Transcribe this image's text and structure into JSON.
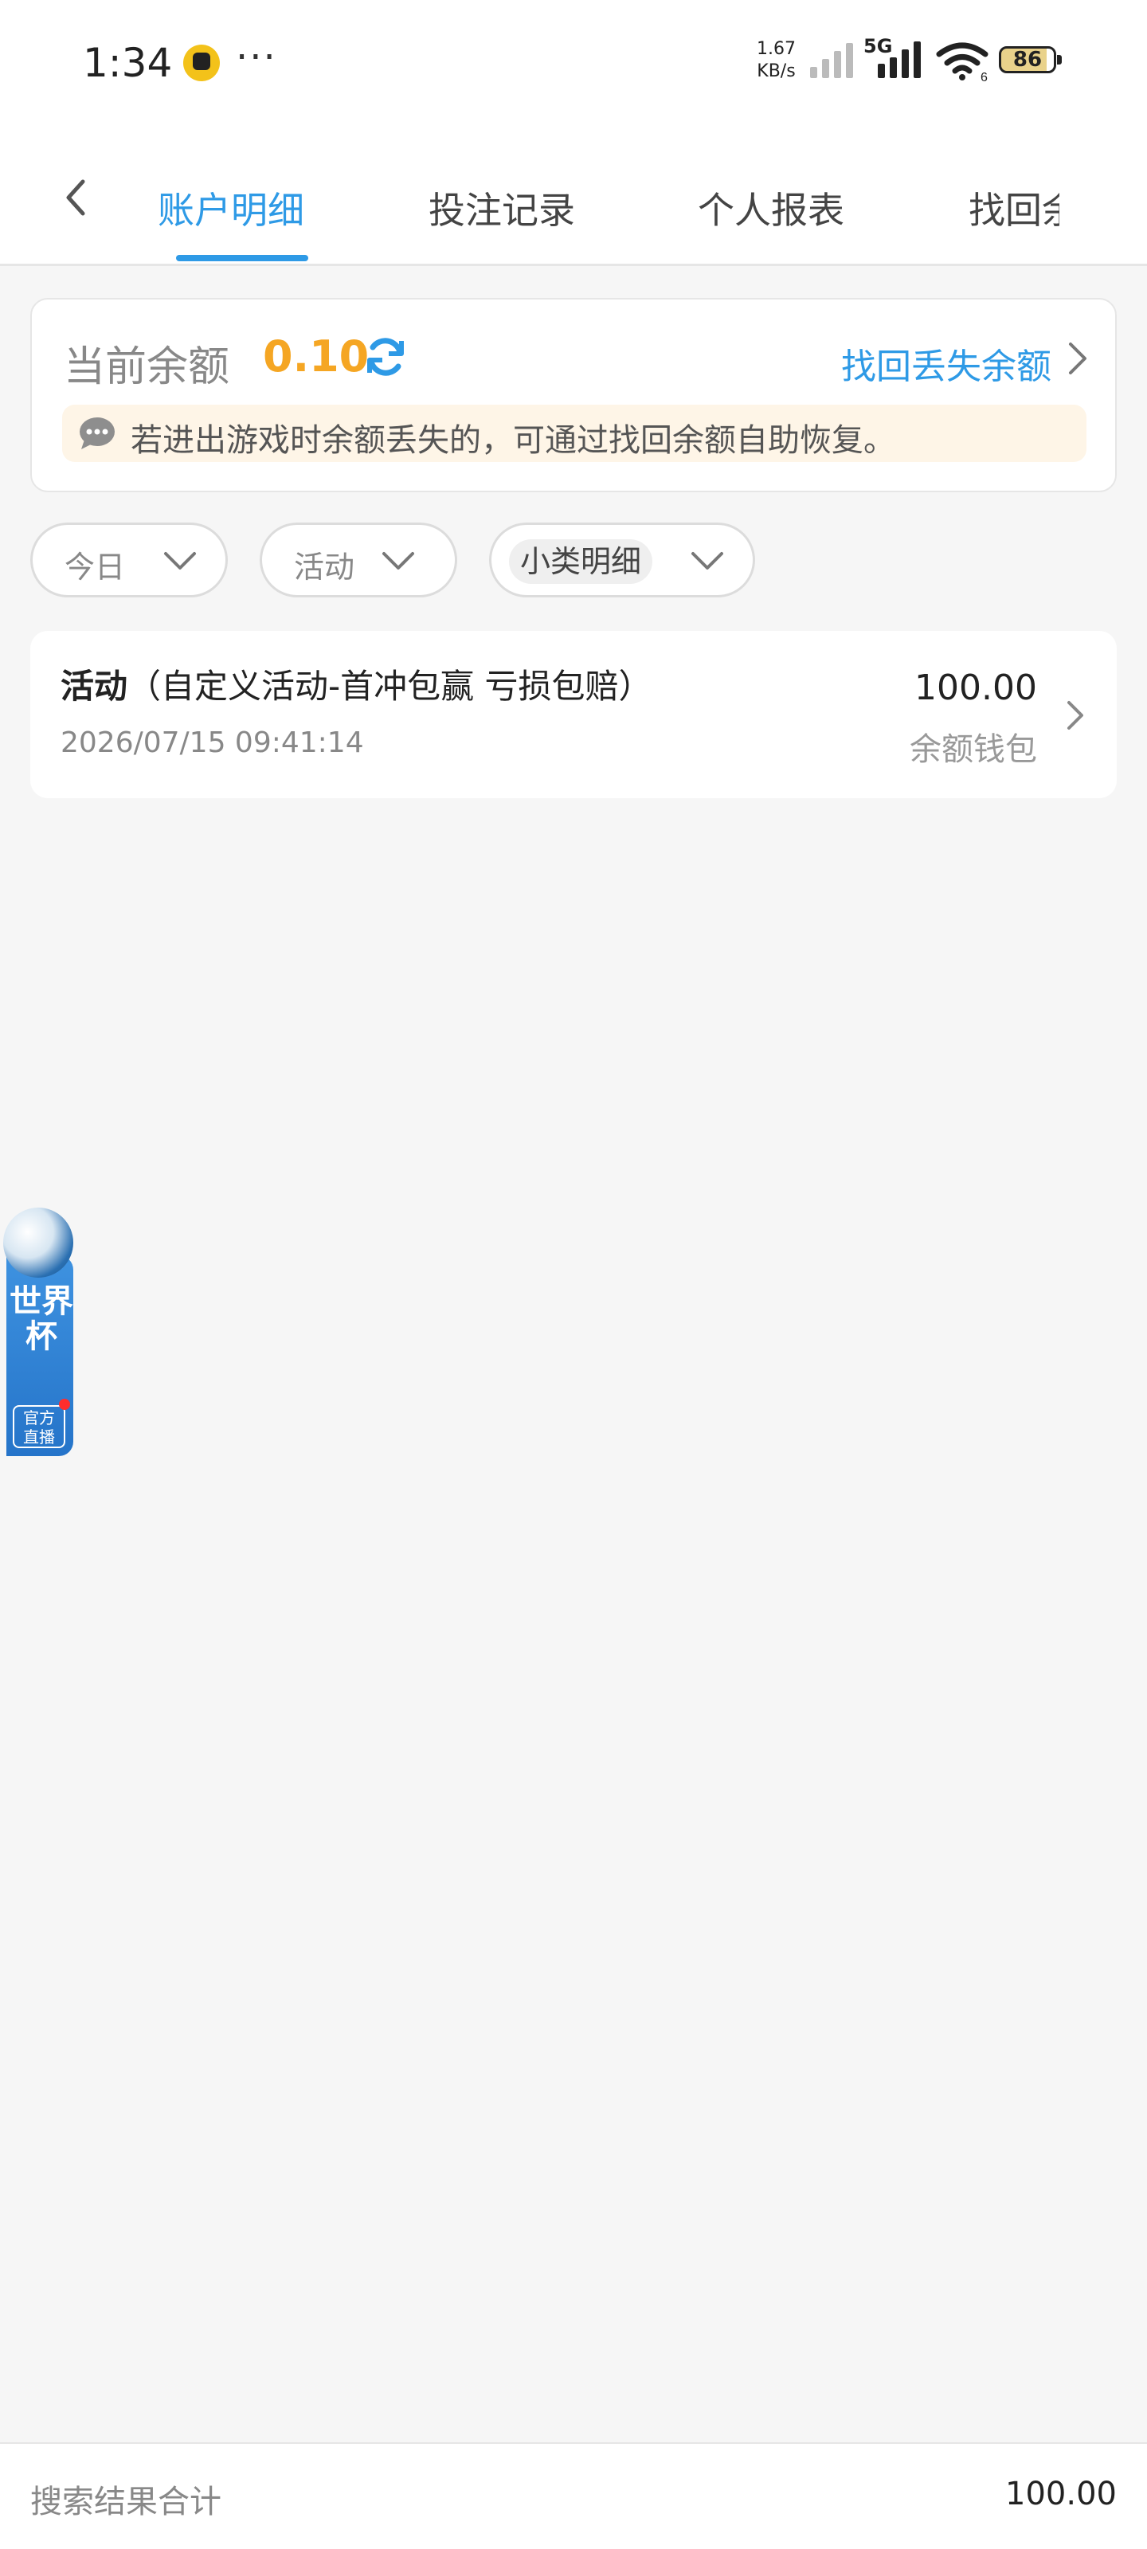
{
  "status_bar": {
    "time": "1:34",
    "more": "···",
    "net_speed_value": "1.67",
    "net_speed_unit": "KB/s",
    "network_type": "5G",
    "wifi_sub": "6",
    "battery": "86"
  },
  "nav": {
    "tabs": [
      {
        "label": "账户明细",
        "active": true
      },
      {
        "label": "投注记录",
        "active": false
      },
      {
        "label": "个人报表",
        "active": false
      },
      {
        "label": "找回余额",
        "active": false
      }
    ],
    "accent_color": "#2e9ae6"
  },
  "balance": {
    "label": "当前余额",
    "value": "0.10",
    "recover_link": "找回丢失余额",
    "notice": "若进出游戏时余额丢失的，可通过找回余额自助恢复。",
    "value_color": "#f5a623"
  },
  "filters": {
    "date": "今日",
    "category": "活动",
    "subcategory": "小类明细"
  },
  "records": [
    {
      "type": "活动",
      "detail": "（自定义活动-首冲包赢 亏损包赔）",
      "time": "2026/07/15 09:41:14",
      "amount": "100.00",
      "wallet": "余额钱包"
    }
  ],
  "float_widget": {
    "text": "世界杯",
    "badge_line1": "官方",
    "badge_line2": "直播"
  },
  "summary": {
    "label": "搜索结果合计",
    "total": "100.00"
  }
}
